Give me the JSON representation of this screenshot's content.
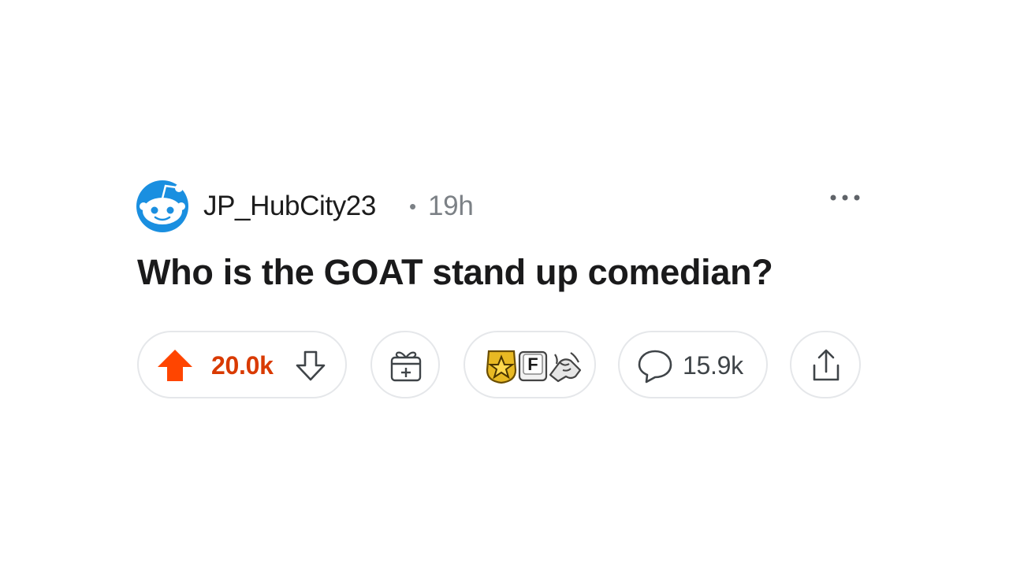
{
  "post": {
    "author": {
      "username": "JP_HubCity23",
      "separator": "•",
      "time_ago": "19h",
      "avatar_icon": "snoo-avatar-icon"
    },
    "title": "Who is the GOAT stand up comedian?",
    "more_icon": "more-options-icon"
  },
  "actions": {
    "upvote_icon": "upvote-arrow-icon",
    "vote_count": "20.0k",
    "downvote_icon": "downvote-arrow-icon",
    "give_award_icon": "gift-box-plus-icon",
    "awards": {
      "icons": [
        "gold-star-award-icon",
        "press-f-award-icon",
        "handshake-award-icon"
      ],
      "letter": "F"
    },
    "comment_icon": "comment-bubble-icon",
    "comment_count": "15.9k",
    "share_icon": "share-upload-icon"
  },
  "colors": {
    "upvote_active": "#ff4500",
    "vote_count": "#d93a00",
    "avatar_blue": "#1a8fe0",
    "muted_text": "#7c8186",
    "pill_border": "#e5e7ea"
  }
}
